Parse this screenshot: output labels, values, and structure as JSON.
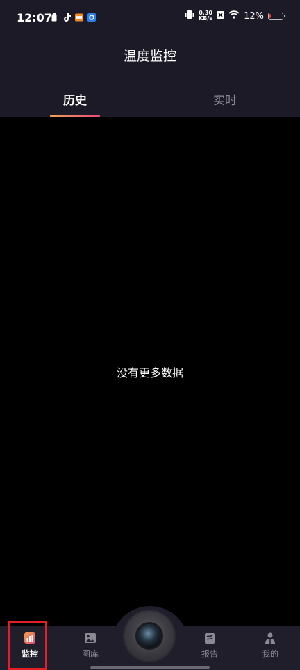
{
  "status_bar": {
    "time": "12:07",
    "net_speed_value": "0.30",
    "net_speed_unit": "KB/s",
    "battery_percent": "12%",
    "battery_level": 0.12,
    "battery_color": "#e53935",
    "icons": [
      "sim-icon",
      "tiktok-icon",
      "notification-app-icon",
      "app-badge-icon",
      "vibrate-icon",
      "close-x-icon",
      "wifi-icon",
      "battery-icon"
    ]
  },
  "header": {
    "title": "温度监控",
    "tabs": [
      {
        "label": "历史",
        "active": true
      },
      {
        "label": "实时",
        "active": false
      }
    ],
    "accent_gradient": [
      "#f0a256",
      "#e64b7e"
    ]
  },
  "content": {
    "empty_message": "没有更多数据"
  },
  "bottom_nav": {
    "items": [
      {
        "label": "监控",
        "icon": "monitor-chart-icon",
        "active": true
      },
      {
        "label": "图库",
        "icon": "gallery-image-icon",
        "active": false
      },
      {
        "label": "",
        "icon": "camera-lens-icon",
        "active": false
      },
      {
        "label": "报告",
        "icon": "report-icon",
        "active": false
      },
      {
        "label": "我的",
        "icon": "person-icon",
        "active": false
      }
    ],
    "highlight_color": "#e21f26"
  }
}
